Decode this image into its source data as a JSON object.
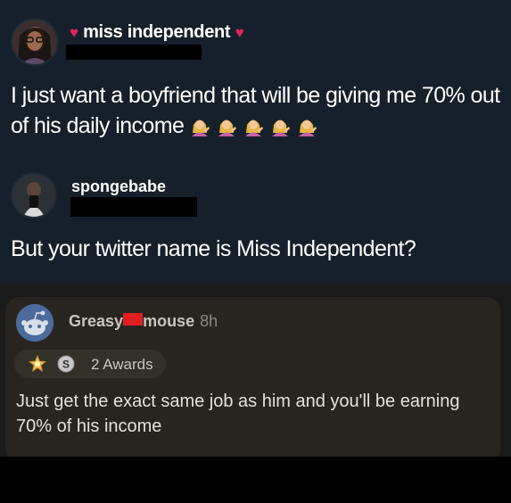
{
  "tweet1": {
    "display_name": "miss independent",
    "text": "I just want a boyfriend that will be giving me 70% out of his daily income",
    "emoji_count": 5
  },
  "tweet2": {
    "display_name": "spongebabe",
    "text": "But your twitter name is Miss Independent?"
  },
  "reddit": {
    "username_start": "Greasy",
    "username_end": "mouse",
    "time": "8h",
    "awards": "2 Awards",
    "comment": "Just get the exact same job as him and you'll be earning 70% of his income"
  },
  "colors": {
    "twitter_bg": "#15202b",
    "reddit_card": "#282520",
    "heart": "#e0245e",
    "redaction_red": "#e02020"
  }
}
